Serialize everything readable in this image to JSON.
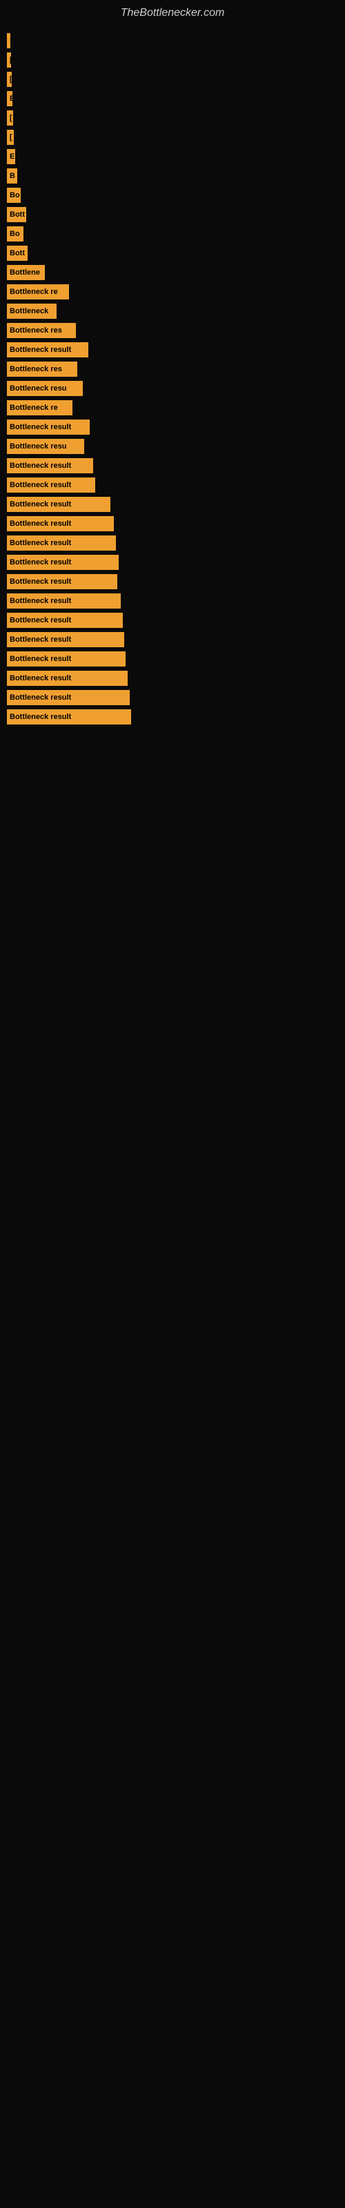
{
  "site": {
    "title": "TheBottlenecker.com"
  },
  "bars": [
    {
      "label": "|",
      "width": 5
    },
    {
      "label": "[",
      "width": 6
    },
    {
      "label": "[",
      "width": 7
    },
    {
      "label": "E",
      "width": 8
    },
    {
      "label": "[",
      "width": 9
    },
    {
      "label": "[",
      "width": 10
    },
    {
      "label": "E",
      "width": 12
    },
    {
      "label": "B",
      "width": 15
    },
    {
      "label": "Bo",
      "width": 20
    },
    {
      "label": "Bott",
      "width": 28
    },
    {
      "label": "Bo",
      "width": 24
    },
    {
      "label": "Bott",
      "width": 30
    },
    {
      "label": "Bottlene",
      "width": 55
    },
    {
      "label": "Bottleneck re",
      "width": 90
    },
    {
      "label": "Bottleneck",
      "width": 72
    },
    {
      "label": "Bottleneck res",
      "width": 100
    },
    {
      "label": "Bottleneck result",
      "width": 118
    },
    {
      "label": "Bottleneck res",
      "width": 102
    },
    {
      "label": "Bottleneck resu",
      "width": 110
    },
    {
      "label": "Bottleneck re",
      "width": 95
    },
    {
      "label": "Bottleneck result",
      "width": 120
    },
    {
      "label": "Bottleneck resu",
      "width": 112
    },
    {
      "label": "Bottleneck result",
      "width": 125
    },
    {
      "label": "Bottleneck result",
      "width": 128
    },
    {
      "label": "Bottleneck result",
      "width": 150
    },
    {
      "label": "Bottleneck result",
      "width": 155
    },
    {
      "label": "Bottleneck result",
      "width": 158
    },
    {
      "label": "Bottleneck result",
      "width": 162
    },
    {
      "label": "Bottleneck result",
      "width": 160
    },
    {
      "label": "Bottleneck result",
      "width": 165
    },
    {
      "label": "Bottleneck result",
      "width": 168
    },
    {
      "label": "Bottleneck result",
      "width": 170
    },
    {
      "label": "Bottleneck result",
      "width": 172
    },
    {
      "label": "Bottleneck result",
      "width": 175
    },
    {
      "label": "Bottleneck result",
      "width": 178
    },
    {
      "label": "Bottleneck result",
      "width": 180
    }
  ]
}
